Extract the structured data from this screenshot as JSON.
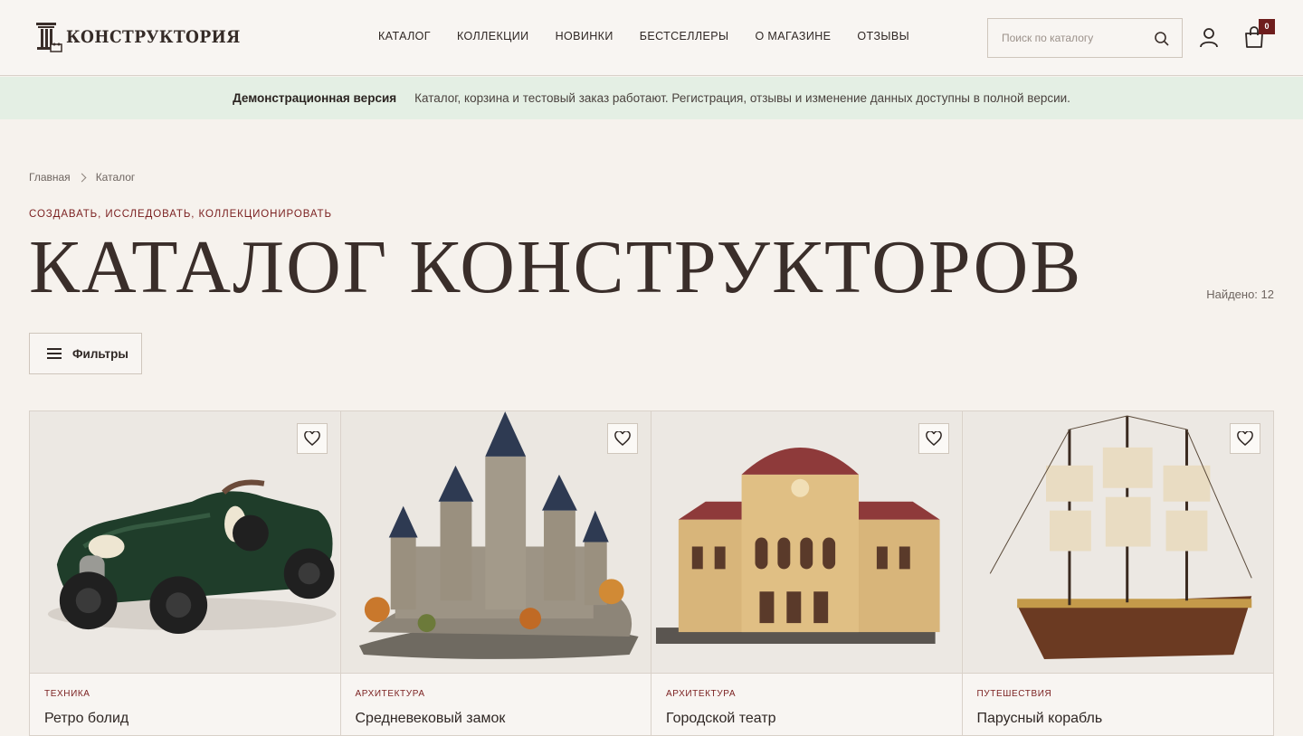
{
  "brand": {
    "name": "КОНСТРУКТОРИЯ"
  },
  "nav": [
    {
      "label": "КАТАЛОГ"
    },
    {
      "label": "КОЛЛЕКЦИИ"
    },
    {
      "label": "НОВИНКИ"
    },
    {
      "label": "БЕСТСЕЛЛЕРЫ"
    },
    {
      "label": "О МАГАЗИНЕ"
    },
    {
      "label": "ОТЗЫВЫ"
    }
  ],
  "search": {
    "placeholder": "Поиск по каталогу",
    "icon": "search-icon"
  },
  "account": {
    "icon": "user-icon"
  },
  "cart": {
    "icon": "shopping-bag-icon",
    "count": "0"
  },
  "demo": {
    "title": "Демонстрационная версия",
    "message": "Каталог, корзина и тестовый заказ работают. Регистрация, отзывы и изменение данных доступны в полной версии."
  },
  "breadcrumb": [
    {
      "label": "Главная"
    },
    {
      "label": "Каталог"
    }
  ],
  "eyebrow": "СОЗДАВАТЬ, ИССЛЕДОВАТЬ, КОЛЛЕКЦИОНИРОВАТЬ",
  "title": "КАТАЛОГ КОНСТРУКТОРОВ",
  "found": "Найдено: 12",
  "filters": {
    "label": "Фильтры"
  },
  "products": [
    {
      "category": "ТЕХНИКА",
      "name": "Ретро болид",
      "image": "green retro race car model"
    },
    {
      "category": "АРХИТЕКТУРА",
      "name": "Средневековый замок",
      "image": "medieval castle model"
    },
    {
      "category": "АРХИТЕКТУРА",
      "name": "Городской театр",
      "image": "city theatre building model"
    },
    {
      "category": "ПУТЕШЕСТВИЯ",
      "name": "Парусный корабль",
      "image": "sailing ship model"
    }
  ],
  "colors": {
    "accent": "#7a1f1f",
    "badge": "#6e1d1d",
    "demo_bg": "#e4efe4",
    "page_bg": "#f6f2ed"
  }
}
